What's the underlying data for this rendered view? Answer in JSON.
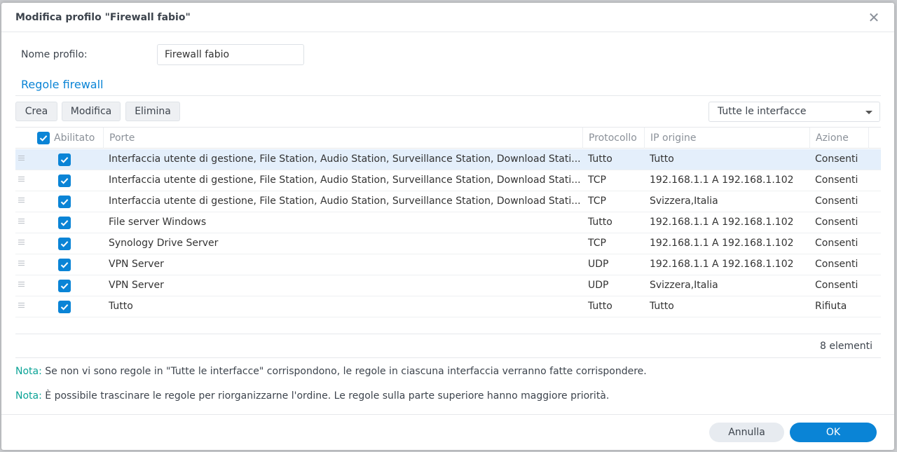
{
  "dialog": {
    "title": "Modifica profilo \"Firewall fabio\"",
    "close_icon": "close-icon"
  },
  "profile": {
    "name_label": "Nome profilo:",
    "name_value": "Firewall fabio"
  },
  "section_title": "Regole firewall",
  "toolbar": {
    "create_label": "Crea",
    "edit_label": "Modifica",
    "delete_label": "Elimina",
    "interface_selected": "Tutte le interfacce"
  },
  "table": {
    "headers": {
      "enabled": "Abilitato",
      "ports": "Porte",
      "protocol": "Protocollo",
      "source_ip": "IP origine",
      "action": "Azione"
    },
    "rows": [
      {
        "enabled": true,
        "ports": "Interfaccia utente di gestione, File Station, Audio Station, Surveillance Station, Download Stati...",
        "protocol": "Tutto",
        "source_ip": "Tutto",
        "action": "Consenti"
      },
      {
        "enabled": true,
        "ports": "Interfaccia utente di gestione, File Station, Audio Station, Surveillance Station, Download Stati...",
        "protocol": "TCP",
        "source_ip": "192.168.1.1 A 192.168.1.102",
        "action": "Consenti"
      },
      {
        "enabled": true,
        "ports": "Interfaccia utente di gestione, File Station, Audio Station, Surveillance Station, Download Stati...",
        "protocol": "TCP",
        "source_ip": "Svizzera,Italia",
        "action": "Consenti"
      },
      {
        "enabled": true,
        "ports": "File server Windows",
        "protocol": "Tutto",
        "source_ip": "192.168.1.1 A 192.168.1.102",
        "action": "Consenti"
      },
      {
        "enabled": true,
        "ports": "Synology Drive Server",
        "protocol": "TCP",
        "source_ip": "192.168.1.1 A 192.168.1.102",
        "action": "Consenti"
      },
      {
        "enabled": true,
        "ports": "VPN Server",
        "protocol": "UDP",
        "source_ip": "192.168.1.1 A 192.168.1.102",
        "action": "Consenti"
      },
      {
        "enabled": true,
        "ports": "VPN Server",
        "protocol": "UDP",
        "source_ip": "Svizzera,Italia",
        "action": "Consenti"
      },
      {
        "enabled": true,
        "ports": "Tutto",
        "protocol": "Tutto",
        "source_ip": "Tutto",
        "action": "Rifiuta"
      }
    ],
    "count": "8 elementi"
  },
  "notes": [
    {
      "tag": "Nota:",
      "text": "Se non vi sono regole in \"Tutte le interfacce\" corrispondono, le regole in ciascuna interfaccia verranno fatte corrispondere."
    },
    {
      "tag": "Nota:",
      "text": "È possibile trascinare le regole per riorganizzarne l'ordine. Le regole sulla parte superiore hanno maggiore priorità."
    }
  ],
  "footer": {
    "cancel_label": "Annulla",
    "ok_label": "OK"
  },
  "colors": {
    "accent": "#0a84d6",
    "note_tag": "#0aa396",
    "selected_row": "#e4effb"
  }
}
